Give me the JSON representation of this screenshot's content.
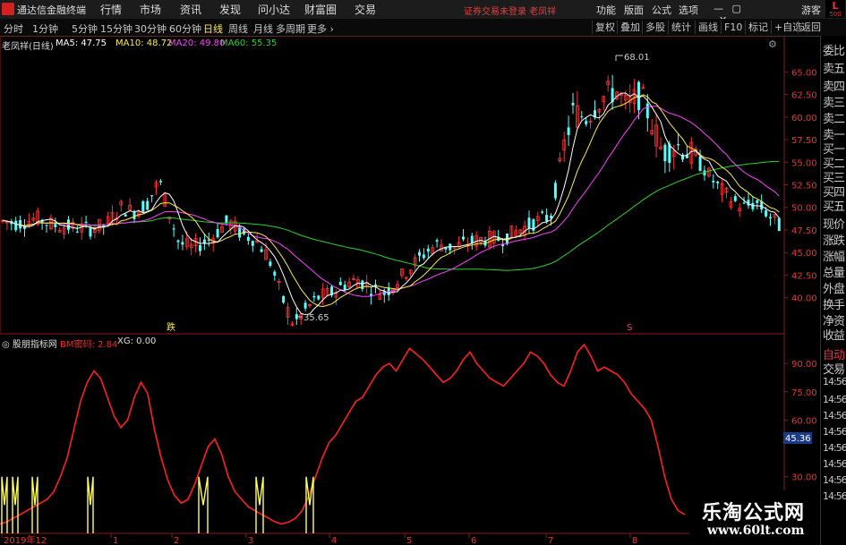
{
  "app": {
    "name": "通达信金融终端",
    "menu": [
      "行情",
      "市场",
      "资讯",
      "发现",
      "问小达",
      "财富圈",
      "交易"
    ],
    "warning": "证券交易未登录  老凤祥",
    "right_menu": [
      "功能",
      "版面",
      "公式",
      "选项"
    ],
    "guest": "游客",
    "badge_letter": "L",
    "badge_num": "500"
  },
  "periods": {
    "tabs": [
      "分时",
      "1分钟",
      "5分钟",
      "15分钟",
      "30分钟",
      "60分钟",
      "日线",
      "周线",
      "月线",
      "多周期",
      "更多"
    ],
    "active": "日线",
    "tools": [
      "复权",
      "叠加",
      "多股",
      "统计",
      "画线",
      "F10",
      "标记",
      "+自选",
      "返回"
    ]
  },
  "main_legend": {
    "title": "老凤祥(日线)",
    "ma5": "MA5: 47.75",
    "ma10": "MA10: 48.72",
    "ma20": "MA20: 49.80",
    "ma60": "MA60: 55.35"
  },
  "sub_legend": {
    "title": "股朋指标网",
    "bm": "BM密码: 2.84",
    "xg": "XG: 0.00"
  },
  "annotations": {
    "high": "68.01",
    "low": "35.65",
    "fall_marker": "跌",
    "s_marker": "S"
  },
  "price_axis": [
    "65.00",
    "62.50",
    "60.00",
    "57.50",
    "55.00",
    "52.50",
    "50.00",
    "47.50",
    "45.00",
    "42.50",
    "40.00"
  ],
  "ind_axis": [
    "90.00",
    "75.00",
    "60.00",
    "45.36",
    "30.00"
  ],
  "current_ind": "45.36",
  "x_axis": [
    "2019年12",
    "1",
    "2",
    "3",
    "4",
    "5",
    "6",
    "7",
    "8"
  ],
  "side_panel": [
    "委比",
    "卖五",
    "卖四",
    "卖三",
    "卖二",
    "卖一",
    "买一",
    "买二",
    "买三",
    "买四",
    "买五",
    "现价",
    "涨跌",
    "涨幅",
    "总量",
    "外盘",
    "换手",
    "净资",
    "收益",
    "自动",
    "交易",
    "14:56",
    "14:56",
    "14:56",
    "14:56",
    "14:56",
    "14:56",
    "14:56",
    "14:56"
  ],
  "watermark": {
    "title": "乐淘公式网",
    "url": "www.60lt.com"
  },
  "colors": {
    "up": "#ff3232",
    "down": "#54ffff",
    "ma5": "#ffffff",
    "ma10": "#ffeb3b",
    "ma20": "#ff40ff",
    "ma60": "#2bd42b",
    "bm": "#ff2020",
    "xg": "#ffff55"
  },
  "chart_data": {
    "type": "candlestick",
    "price_range": [
      36,
      69
    ],
    "indicator_range": [
      0,
      100
    ],
    "bm_series": [
      5,
      6,
      8,
      10,
      12,
      14,
      16,
      18,
      22,
      30,
      40,
      55,
      70,
      80,
      86,
      82,
      72,
      62,
      56,
      60,
      72,
      80,
      74,
      55,
      40,
      28,
      20,
      16,
      18,
      26,
      36,
      46,
      50,
      42,
      30,
      22,
      18,
      14,
      12,
      10,
      8,
      6,
      5,
      6,
      8,
      12,
      20,
      30,
      40,
      48,
      52,
      58,
      64,
      70,
      72,
      78,
      84,
      88,
      90,
      86,
      92,
      98,
      95,
      92,
      88,
      84,
      80,
      82,
      86,
      92,
      96,
      90,
      86,
      82,
      80,
      78,
      82,
      86,
      90,
      96,
      94,
      90,
      84,
      80,
      78,
      86,
      96,
      100,
      94,
      86,
      88,
      86,
      84,
      80,
      74,
      70,
      66,
      60,
      46,
      30,
      18,
      12,
      10
    ]
  }
}
